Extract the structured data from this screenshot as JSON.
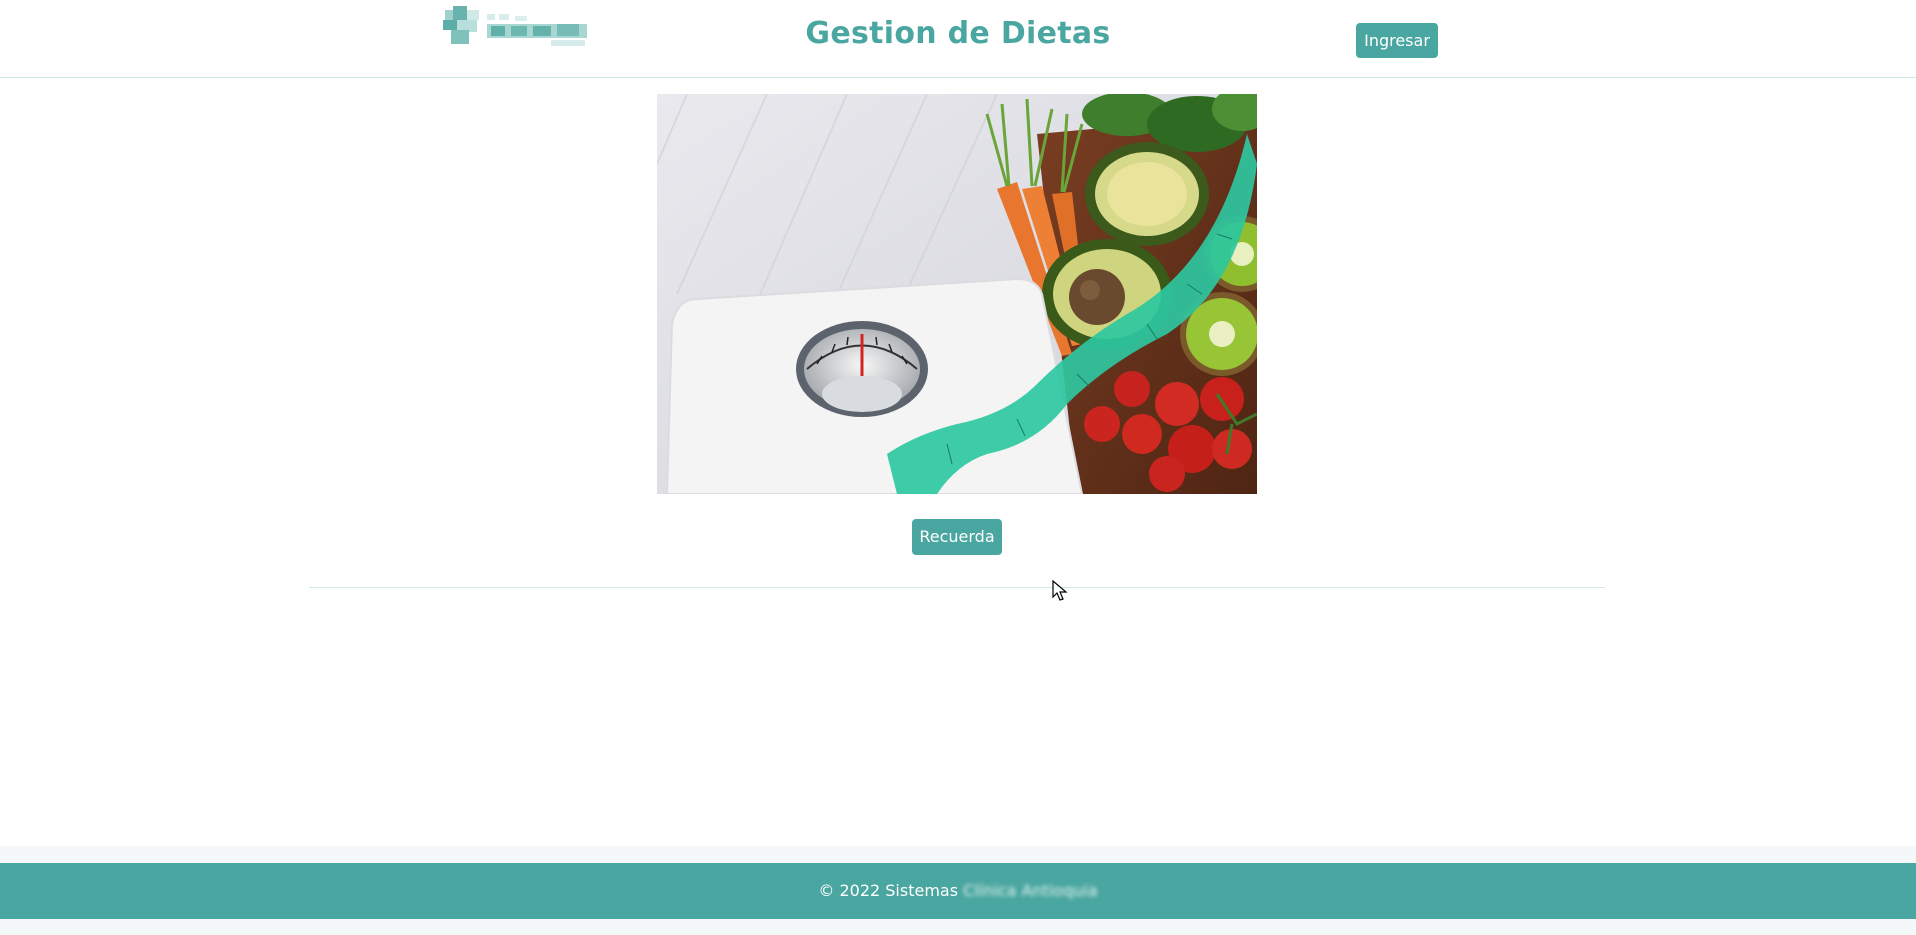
{
  "header": {
    "logo_icon": "clinic-logo",
    "title": "Gestion de Dietas",
    "login_label": "Ingresar"
  },
  "hero": {
    "image_icon": "diet-scale-vegetables-image",
    "button_label": "Recuerda"
  },
  "footer": {
    "copyright": "© 2022 Sistemas",
    "blurred_name": "Clínica Antioquia"
  },
  "colors": {
    "accent": "#4aa6a0",
    "footer_bg": "#4aa6a0",
    "page_bg": "#ffffff"
  }
}
